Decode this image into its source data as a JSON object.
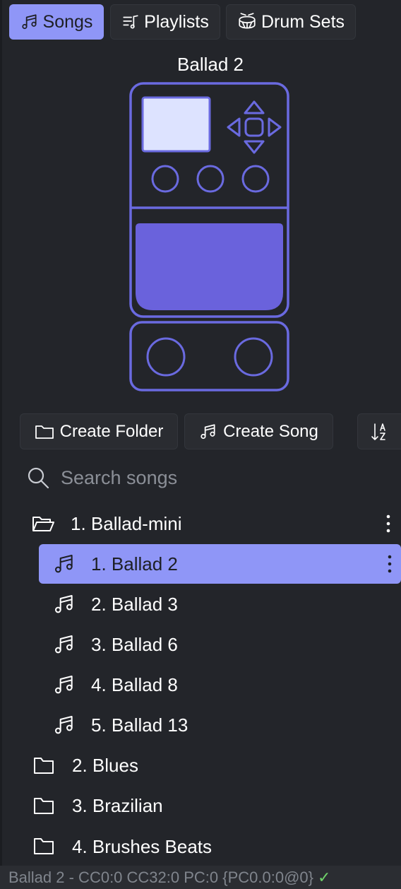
{
  "tabs": [
    {
      "label": "Songs",
      "icon": "music-note-icon",
      "active": true
    },
    {
      "label": "Playlists",
      "icon": "playlist-icon",
      "active": false
    },
    {
      "label": "Drum Sets",
      "icon": "drum-icon",
      "active": false
    }
  ],
  "device": {
    "title": "Ballad 2"
  },
  "actions": {
    "create_folder": "Create Folder",
    "create_song": "Create Song",
    "sort_icon": "sort-az-icon"
  },
  "search": {
    "placeholder": "Search songs",
    "value": ""
  },
  "tree": {
    "folder_open": {
      "label": "1. Ballad-mini",
      "icon": "folder-open-icon"
    },
    "songs": [
      {
        "label": "1. Ballad 2",
        "selected": true
      },
      {
        "label": "2. Ballad 3",
        "selected": false
      },
      {
        "label": "3. Ballad 6",
        "selected": false
      },
      {
        "label": "4. Ballad 8",
        "selected": false
      },
      {
        "label": "5. Ballad 13",
        "selected": false
      }
    ],
    "folders": [
      {
        "label": "2. Blues"
      },
      {
        "label": "3. Brazilian"
      },
      {
        "label": "4. Brushes Beats"
      }
    ]
  },
  "status": {
    "text": "Ballad 2 - CC0:0 CC32:0 PC:0 {PC0.0:0@0}",
    "check": "✓"
  },
  "colors": {
    "accent": "#8f96f7",
    "device_stroke": "#6a6ae0",
    "device_fill": "#6a62dc",
    "screen": "#dde3ff",
    "background": "#23252a"
  }
}
